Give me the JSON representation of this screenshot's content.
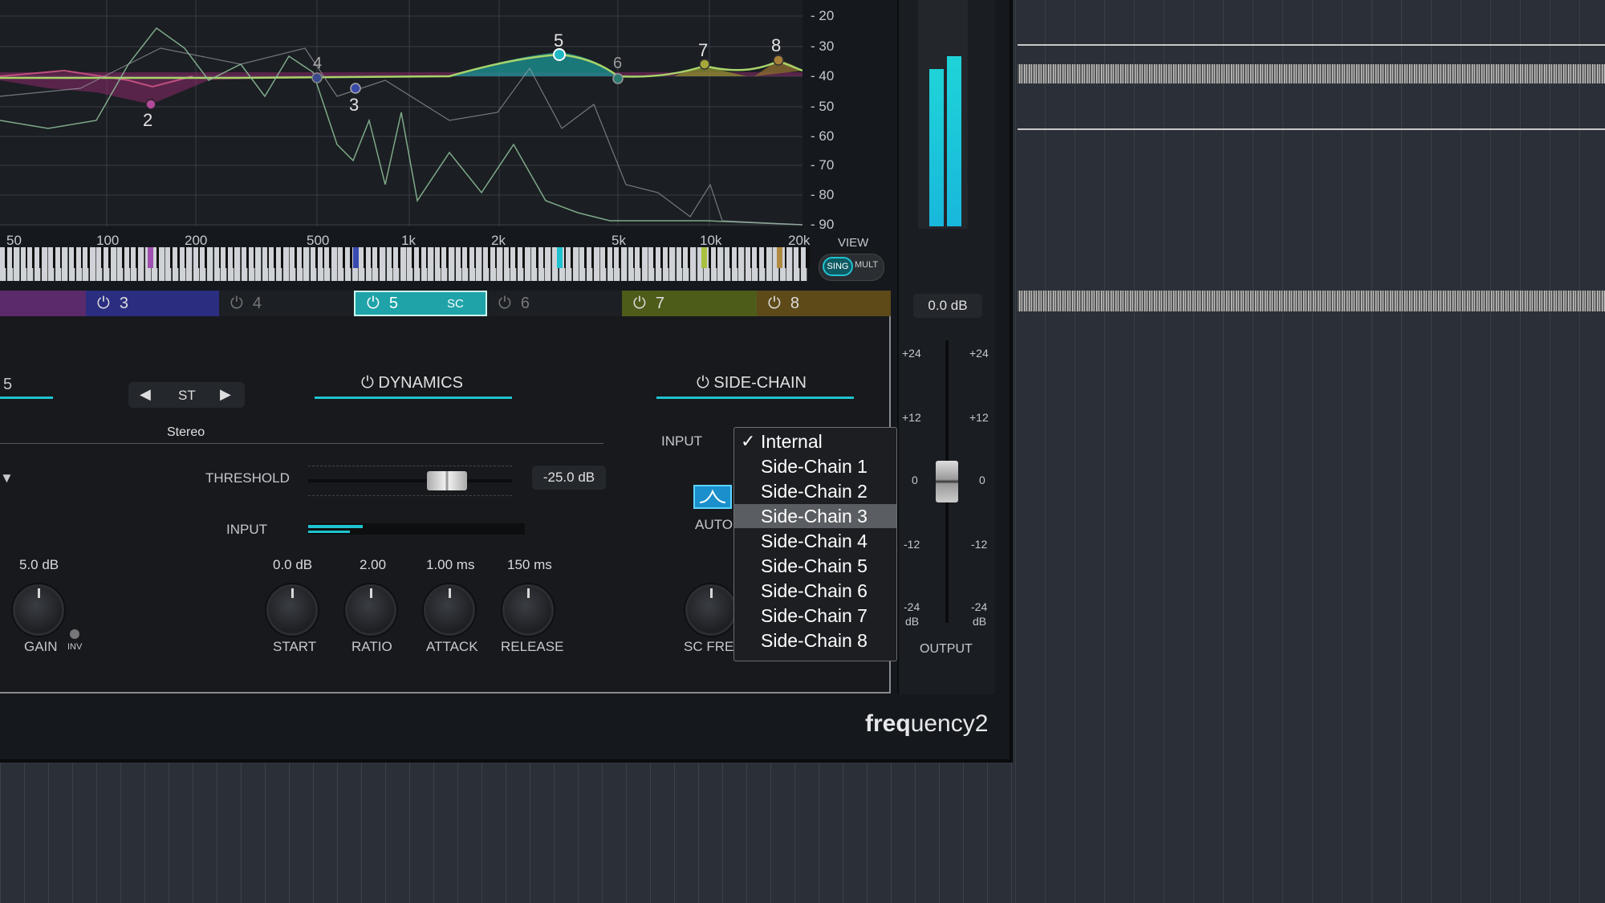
{
  "eq": {
    "db_labels": [
      "- 20",
      "- 30",
      "- 40",
      "- 50",
      "- 60",
      "- 70",
      "- 80",
      "- 90"
    ],
    "freq_labels": [
      "50",
      "100",
      "200",
      "500",
      "1k",
      "2k",
      "5k",
      "10k",
      "20k"
    ],
    "node_labels": [
      "2",
      "3",
      "4",
      "5",
      "6",
      "7",
      "8"
    ],
    "view_label": "VIEW",
    "view_sing": "SING",
    "view_mult": "MULT"
  },
  "bands": [
    {
      "num": "3",
      "color": "#3b3d9a",
      "extra": ""
    },
    {
      "num": "4",
      "color": "#1d2025",
      "extra": ""
    },
    {
      "num": "5",
      "color": "#1fa3a8",
      "extra": "SC"
    },
    {
      "num": "6",
      "color": "#1d2025",
      "extra": ""
    },
    {
      "num": "7",
      "color": "#5a6b1c",
      "extra": ""
    },
    {
      "num": "8",
      "color": "#6a531a",
      "extra": ""
    }
  ],
  "band_section": {
    "left_partial": "5",
    "st_label": "ST",
    "stereo_label": "Stereo",
    "dynamics_label": "DYNAMICS",
    "sidechain_label": "SIDE-CHAIN",
    "threshold_label": "THRESHOLD",
    "threshold_value": "-25.0 dB",
    "input_label": "INPUT",
    "input_level": 0.25,
    "sc_input_label": "INPUT",
    "auto_label": "AUTO",
    "sc_freq_label": "SC FRE",
    "knobs": [
      {
        "value": "5.0 dB",
        "label": "GAIN"
      },
      {
        "value": "0.0 dB",
        "label": "START"
      },
      {
        "value": "2.00",
        "label": "RATIO"
      },
      {
        "value": "1.00 ms",
        "label": "ATTACK"
      },
      {
        "value": "150 ms",
        "label": "RELEASE"
      }
    ],
    "inv_label": "INV"
  },
  "dropdown": {
    "items": [
      "Internal",
      "Side-Chain 1",
      "Side-Chain 2",
      "Side-Chain 3",
      "Side-Chain 4",
      "Side-Chain 5",
      "Side-Chain 6",
      "Side-Chain 7",
      "Side-Chain 8"
    ],
    "checked_index": 0,
    "highlighted_index": 3
  },
  "output": {
    "value": "0.0 dB",
    "scale_left": [
      "+24",
      "+12",
      "0",
      "-12",
      "-24"
    ],
    "scale_right": [
      "+24",
      "+12",
      "0",
      "-12",
      "-24"
    ],
    "db_unit": "dB",
    "label": "OUTPUT"
  },
  "logo": {
    "bold": "freq",
    "rest": "uency2"
  },
  "colors": {
    "accent": "#1fc3cf",
    "band5": "#1fa3a8"
  }
}
